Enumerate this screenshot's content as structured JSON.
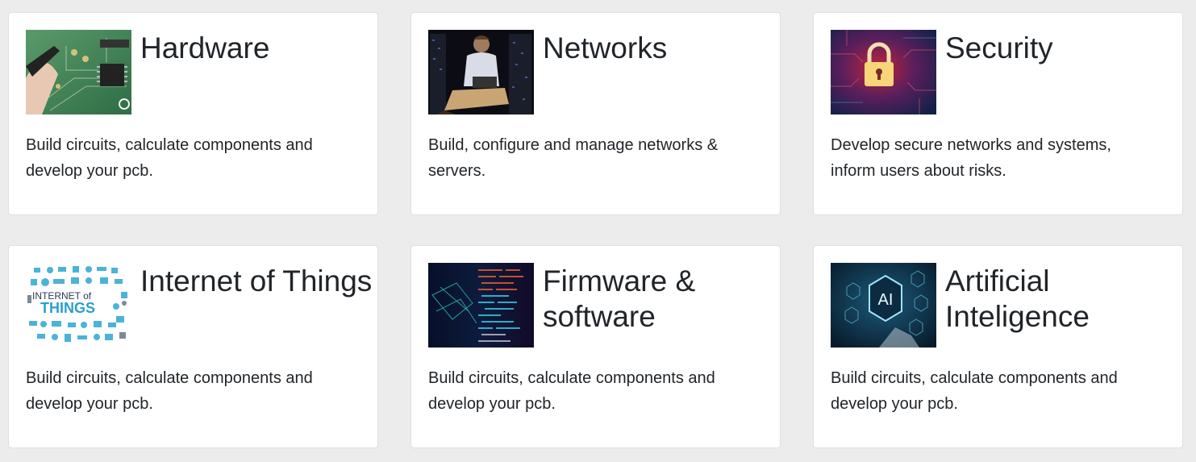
{
  "cards": [
    {
      "title": "Hardware",
      "description": "Build circuits, calculate components and develop your pcb.",
      "image": "pcb-circuit-board-photo"
    },
    {
      "title": "Networks",
      "description": "Build, configure and manage networks & servers.",
      "image": "server-room-technician-photo"
    },
    {
      "title": "Security",
      "description": "Develop secure networks and systems, inform users about risks.",
      "image": "digital-padlock-photo"
    },
    {
      "title": "Internet of Things",
      "description": "Build circuits, calculate components and develop your pcb.",
      "image": "internet-of-things-word-cloud",
      "image_text": [
        "INTERNET of",
        "THINGS"
      ]
    },
    {
      "title": "Firmware & software",
      "description": "Build circuits, calculate components and develop your pcb.",
      "image": "code-screen-photo"
    },
    {
      "title": "Artificial Inteligence",
      "description": "Build circuits, calculate components and develop your pcb.",
      "image": "ai-hexagon-interface-photo",
      "image_text": [
        "AI"
      ]
    }
  ],
  "colors": {
    "page_background": "#ececec",
    "card_background": "#ffffff",
    "card_border": "#dfdfdf",
    "text": "#212529"
  }
}
